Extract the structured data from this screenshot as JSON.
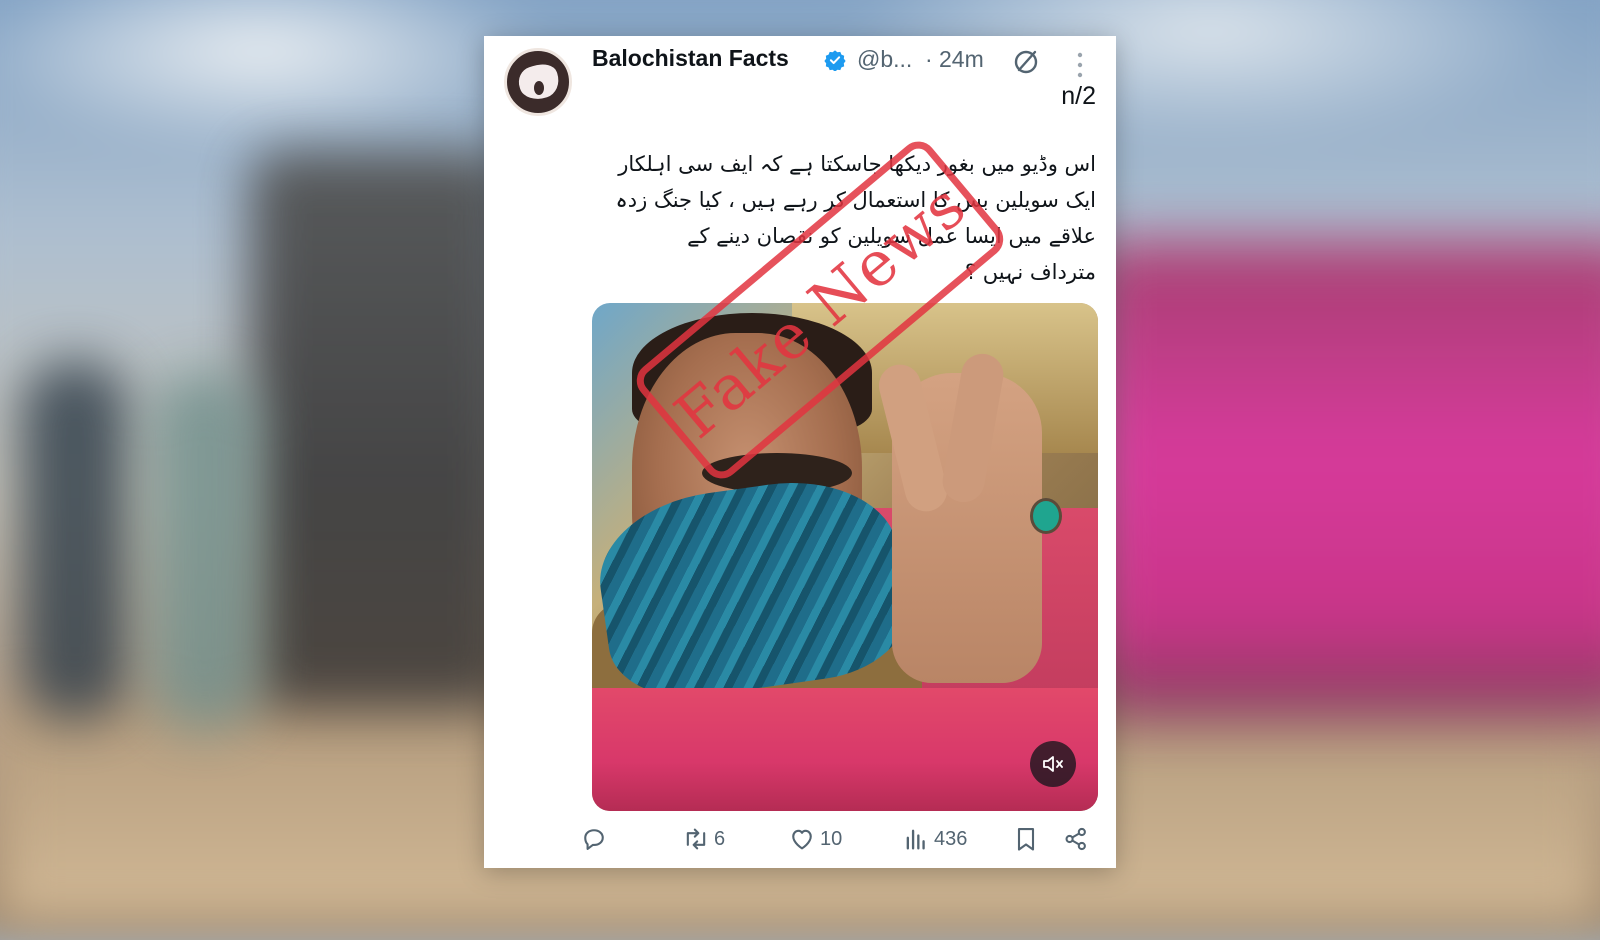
{
  "tweet": {
    "author_name": "Balochistan Facts",
    "handle": "@b...",
    "separator": "·",
    "time": "24m",
    "thread_counter": "n/2",
    "text_lines": [
      "اس وڈیو میں بغور دیکھا جاسکتا ہے کہ ایف سی اہلکار",
      "ایک سویلین بس کا استعمال کر رہے ہیں ، کیا جنگ زدہ",
      "علاقے میں ایسا عمل سویلین کو نقصان دینے کے",
      "مترداف نہیں ؟"
    ],
    "stamp_text": "Fake News",
    "actions": {
      "reply_count": "",
      "retweet_count": "6",
      "like_count": "10",
      "view_count": "436"
    },
    "icons": {
      "verified": "verified-badge-icon",
      "grok": "grok-icon",
      "more": "more-vertical-icon",
      "mute": "speaker-muted-icon",
      "reply": "reply-icon",
      "retweet": "retweet-icon",
      "like": "heart-icon",
      "views": "views-chart-icon",
      "bookmark": "bookmark-icon",
      "share": "share-icon"
    }
  },
  "colors": {
    "verified_blue": "#1d9bf0",
    "secondary_text": "#536471",
    "stamp_red": "#e23440"
  }
}
